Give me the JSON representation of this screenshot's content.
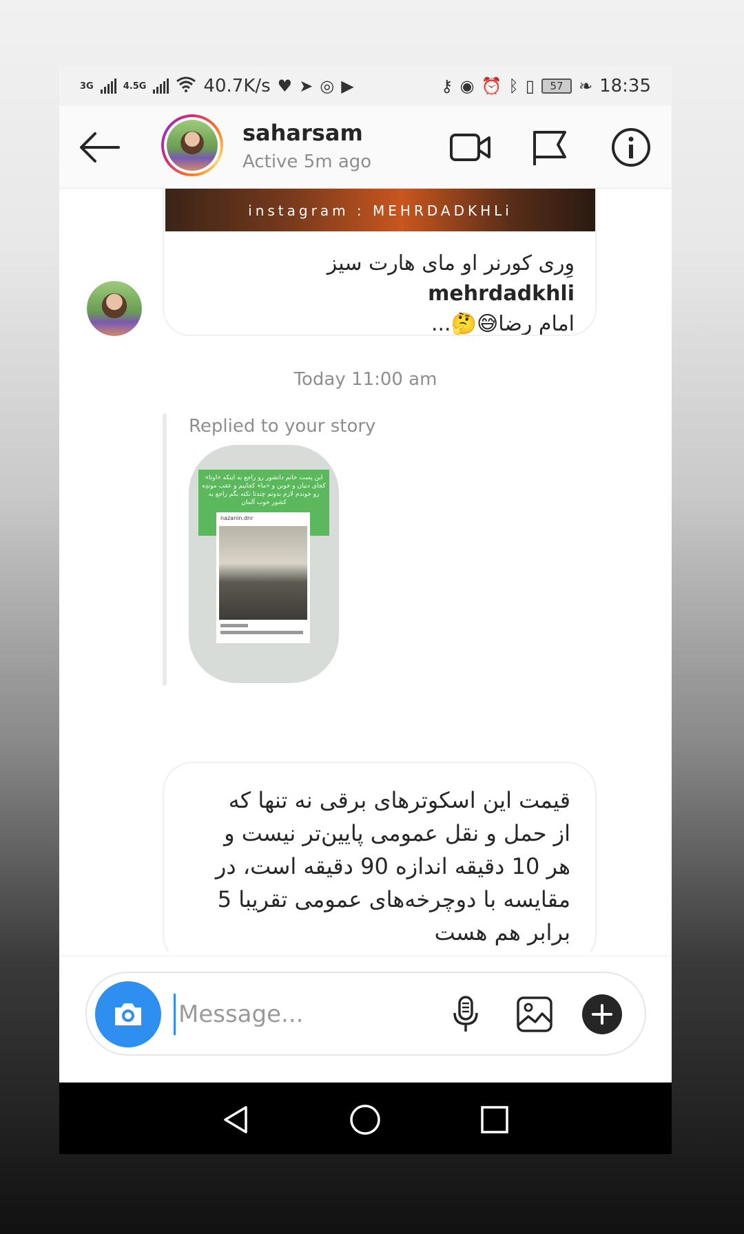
{
  "status_bar": {
    "signal1": "3G",
    "signal2": "4.5G",
    "speed": "40.7K/s",
    "battery": "57",
    "time": "18:35"
  },
  "header": {
    "username": "saharsam",
    "status": "Active 5m ago"
  },
  "shared_post": {
    "image_caption": "instagram : MEHRDADKHLi",
    "author": "mehrdadkhli",
    "text": "وِری کورنر او مای هارت سیز",
    "text_line2": "امام رضا",
    "emojis": "😅🤔",
    "ellipsis": "..."
  },
  "timestamp": "Today 11:00 am",
  "story_reply": {
    "label": "Replied to your story",
    "banner_text": "این پست خانم دانشور رو راجع به اینکه «اونا» کجای دنیان و خوبن و «ما» کجاییم و عقب موندِه رو خوندم لازم بدونم چندتا نکته بگم راجع به کشور خوب آلمان",
    "card_user": "nazanin.dnr"
  },
  "message": {
    "lines": [
      "قیمت این اسکوترهای برقی نه تنها که",
      "از حمل و نقل عمومی پایین‌تر نیست و",
      "هر 10 دقیقه اندازه 90 دقیقه است، در",
      "مقایسه با دوچرخه‌های عمومی تقریبا 5",
      "برابر هم هست"
    ]
  },
  "composer": {
    "placeholder": "Message..."
  },
  "colors": {
    "accent": "#2f8ff0",
    "heart": "#ed2b3d"
  }
}
